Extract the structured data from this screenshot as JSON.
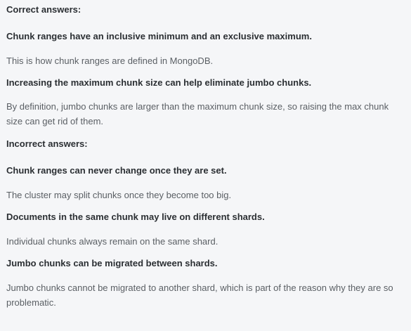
{
  "correct_heading": "Correct answers:",
  "correct": [
    {
      "statement": "Chunk ranges have an inclusive minimum and an exclusive maximum.",
      "explanation": "This is how chunk ranges are defined in MongoDB."
    },
    {
      "statement": "Increasing the maximum chunk size can help eliminate jumbo chunks.",
      "explanation": "By definition, jumbo chunks are larger than the maximum chunk size, so raising the max chunk size can get rid of them."
    }
  ],
  "incorrect_heading": "Incorrect answers:",
  "incorrect": [
    {
      "statement": "Chunk ranges can never change once they are set.",
      "explanation": "The cluster may split chunks once they become too big."
    },
    {
      "statement": "Documents in the same chunk may live on different shards.",
      "explanation": "Individual chunks always remain on the same shard."
    },
    {
      "statement": "Jumbo chunks can be migrated between shards.",
      "explanation": "Jumbo chunks cannot be migrated to another shard, which is part of the reason why they are so problematic."
    }
  ]
}
